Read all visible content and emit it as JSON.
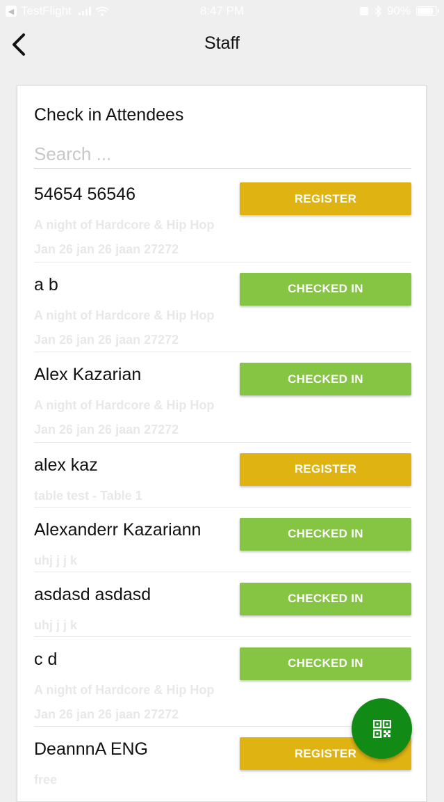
{
  "status_bar": {
    "carrier": "TestFlight",
    "time": "8:47 PM",
    "battery": "90%",
    "battery_level": 0.9
  },
  "nav": {
    "title": "Staff",
    "back_icon": "chevron-left-icon"
  },
  "card": {
    "title": "Check in Attendees",
    "search_placeholder": "Search ..."
  },
  "attendees": [
    {
      "name": "54654 56546",
      "line1": "A night of Hardcore & Hip Hop",
      "line2": "Jan 26 jan 26 jaan 27272",
      "action": "REGISTER"
    },
    {
      "name": "a b",
      "line1": "A night of Hardcore & Hip Hop",
      "line2": "Jan 26 jan 26 jaan 27272",
      "action": "CHECKED IN"
    },
    {
      "name": "Alex Kazarian",
      "line1": "A night of Hardcore & Hip Hop",
      "line2": "Jan 26 jan 26 jaan 27272",
      "action": "CHECKED IN"
    },
    {
      "name": "alex kaz",
      "line1": "table test - Table 1",
      "action": "REGISTER"
    },
    {
      "name": "Alexanderr Kazariann",
      "line1": "uhj j j k",
      "action": "CHECKED IN"
    },
    {
      "name": "asdasd asdasd",
      "line1": "uhj j j k",
      "action": "CHECKED IN"
    },
    {
      "name": "c d",
      "line1": "A night of Hardcore & Hip Hop",
      "line2": "Jan 26 jan 26 jaan 27272",
      "action": "CHECKED IN"
    },
    {
      "name": "DeannnA ENG",
      "line1": "free",
      "action": "REGISTER"
    }
  ],
  "fab": {
    "icon": "qr-code-icon"
  },
  "colors": {
    "register": "#dfb412",
    "checked_in": "#86c443",
    "fab": "#118a16"
  }
}
